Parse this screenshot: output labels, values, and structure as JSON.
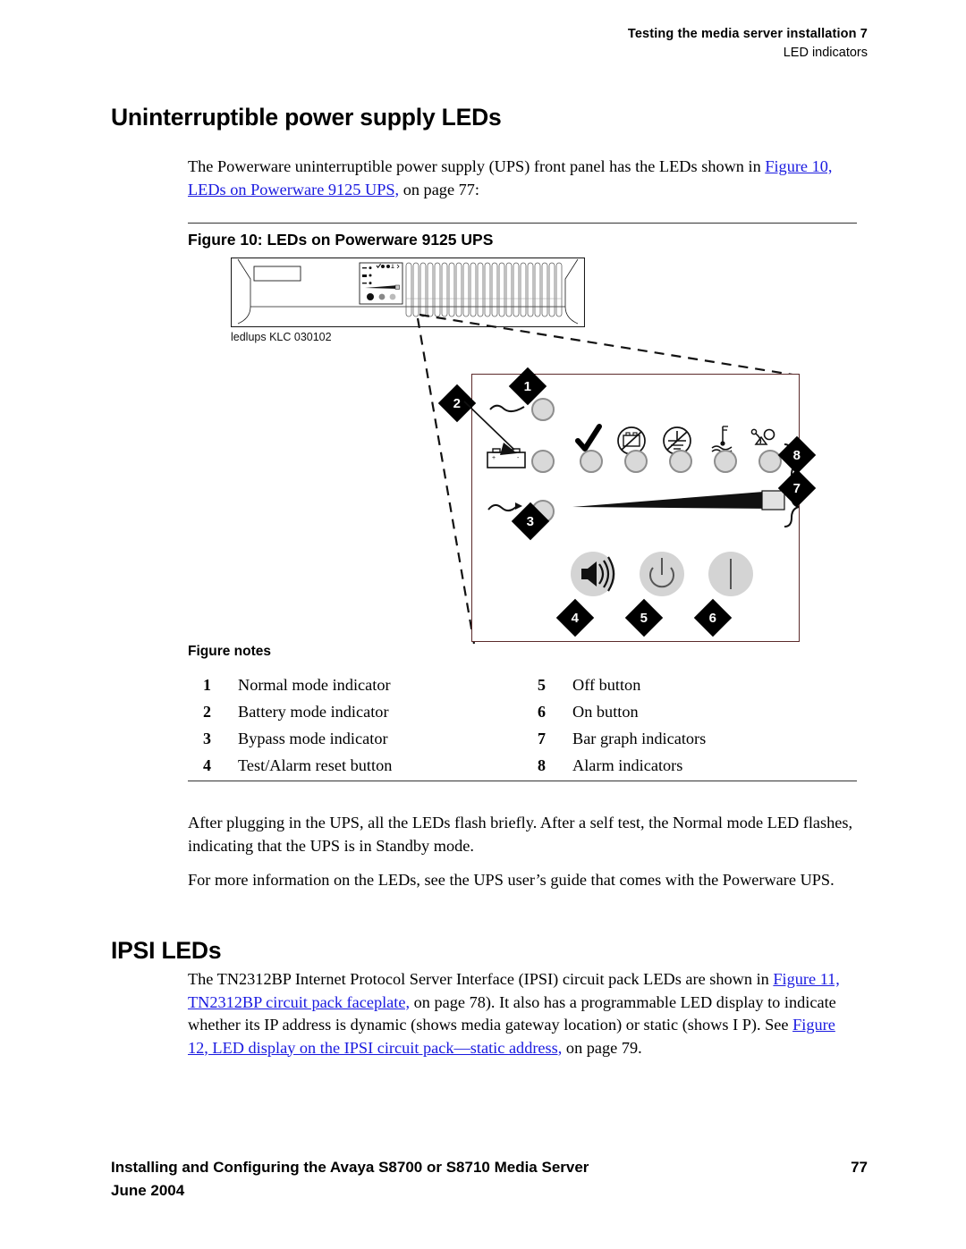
{
  "running_head": {
    "line1": "Testing the media server installation  7",
    "line2": "LED indicators"
  },
  "sections": {
    "ups": {
      "heading": "Uninterruptible power supply LEDs",
      "intro_pre": "The Powerware uninterruptible power supply (UPS) front panel has the LEDs shown in ",
      "intro_link": "Figure 10, LEDs on Powerware 9125 UPS,",
      "intro_post": " on page 77:",
      "para_after_1": "After plugging in the UPS, all the LEDs flash briefly. After a self test, the Normal mode LED flashes, indicating that the UPS is in Standby mode.",
      "para_after_2": "For more information on the LEDs, see the UPS user’s guide that comes with the Powerware UPS."
    },
    "ipsi": {
      "heading": "IPSI LEDs",
      "para_pre": "The TN2312BP Internet Protocol Server Interface (IPSI) circuit pack LEDs are shown in ",
      "link1": "Figure 11, TN2312BP circuit pack faceplate,",
      "mid1": " on page 78). It also has a programmable LED display to indicate whether its IP address is dynamic (shows media gateway location) or static (shows I P). See ",
      "link2": "Figure 12, LED display on the IPSI circuit pack—static address,",
      "post": " on page 79."
    }
  },
  "figure": {
    "caption": "Figure 10: LEDs on Powerware 9125 UPS",
    "artwork_id": "ledlups KLC 030102",
    "notes_heading": "Figure notes",
    "notes": [
      {
        "num": "1",
        "text": "Normal mode indicator"
      },
      {
        "num": "5",
        "text": "Off button"
      },
      {
        "num": "2",
        "text": "Battery mode indicator"
      },
      {
        "num": "6",
        "text": "On button"
      },
      {
        "num": "3",
        "text": "Bypass mode indicator"
      },
      {
        "num": "7",
        "text": "Bar graph indicators"
      },
      {
        "num": "4",
        "text": "Test/Alarm reset button"
      },
      {
        "num": "8",
        "text": "Alarm indicators"
      }
    ],
    "callouts": {
      "c1": "1",
      "c2": "2",
      "c3": "3",
      "c4": "4",
      "c5": "5",
      "c6": "6",
      "c7": "7",
      "c8": "8"
    },
    "icons": {
      "normal_mode": "sine-wave-icon",
      "battery_mode": "battery-icon",
      "bypass_mode": "sine-wave-arrow-icon",
      "alarm_check": "checkmark-icon",
      "alarm_battery_fault": "battery-crossed-icon",
      "alarm_ac_fault": "ac-dc-crossed-icon",
      "alarm_site_wiring": "site-wiring-fault-icon",
      "alarm_overload": "overload-icon",
      "test_alarm_reset": "speaker-icon",
      "off_button": "power-standby-icon",
      "on_button": "power-on-bar-icon"
    }
  },
  "footer": {
    "title": "Installing and Configuring the Avaya S8700 or S8710 Media Server",
    "page": "77",
    "date": "June 2004"
  },
  "colors": {
    "link": "#1a1ae0",
    "led_fill": "#d9d9d9",
    "led_ring": "#8e8e8e",
    "panel_border": "#5b2a2a"
  }
}
